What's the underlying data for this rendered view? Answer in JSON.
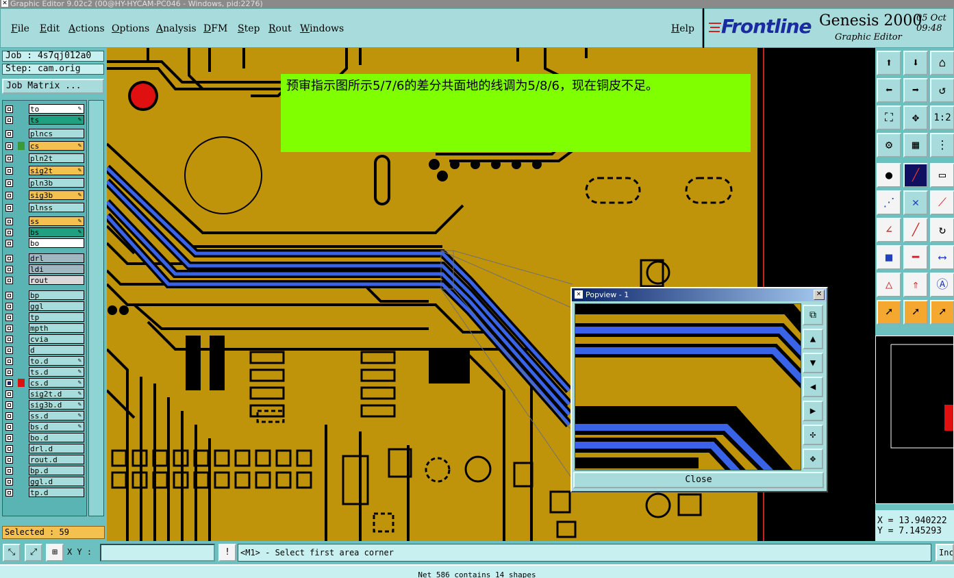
{
  "window": {
    "title": "Graphic Editor 9.02c2 (00@HY-HYCAM-PC046 - Windows, pid:2276)"
  },
  "menu": {
    "items": [
      "File",
      "Edit",
      "Actions",
      "Options",
      "Analysis",
      "DFM",
      "Step",
      "Rout",
      "Windows"
    ],
    "help": "Help"
  },
  "logo": {
    "brand": "Frontline",
    "product": "Genesis 2000",
    "subtitle": "Graphic Editor",
    "date_line1": "05 Oct",
    "date_line2": "09:48"
  },
  "job": {
    "job_label": "Job : 4s7qj012a0",
    "step_label": "Step: cam.orig",
    "matrix_button": "Job Matrix ..."
  },
  "layers": [
    {
      "name": "to",
      "color": "#ffffff",
      "edit": true
    },
    {
      "name": "ts",
      "color": "#20a080",
      "edit": true
    },
    {
      "name": "plncs",
      "color": "#a8dcdc",
      "edit": false
    },
    {
      "name": "cs",
      "color": "#f4c050",
      "edit": true,
      "marker": "#3a9a3a"
    },
    {
      "name": "pln2t",
      "color": "#a8dcdc",
      "edit": false
    },
    {
      "name": "sig2t",
      "color": "#f4c050",
      "edit": true
    },
    {
      "name": "pln3b",
      "color": "#a8dcdc",
      "edit": false
    },
    {
      "name": "sig3b",
      "color": "#f4c050",
      "edit": true
    },
    {
      "name": "plnss",
      "color": "#a8dcdc",
      "edit": false
    },
    {
      "name": "ss",
      "color": "#f4c050",
      "edit": true
    },
    {
      "name": "bs",
      "color": "#20a080",
      "edit": true
    },
    {
      "name": "bo",
      "color": "#ffffff",
      "edit": false
    },
    {
      "name": "drl",
      "color": "#a0b8c0",
      "edit": false
    },
    {
      "name": "ldi",
      "color": "#a0b8c0",
      "edit": false
    },
    {
      "name": "rout",
      "color": "#d8d8d8",
      "edit": false
    },
    {
      "name": "bp",
      "color": "#a8dcdc",
      "edit": false
    },
    {
      "name": "ggl",
      "color": "#a8dcdc",
      "edit": false
    },
    {
      "name": "tp",
      "color": "#a8dcdc",
      "edit": false
    },
    {
      "name": "mpth",
      "color": "#a8dcdc",
      "edit": false
    },
    {
      "name": "cvia",
      "color": "#a8dcdc",
      "edit": false
    },
    {
      "name": "d",
      "color": "#a8dcdc",
      "edit": false
    },
    {
      "name": "to.d",
      "color": "#a8dcdc",
      "edit": true
    },
    {
      "name": "ts.d",
      "color": "#a8dcdc",
      "edit": true
    },
    {
      "name": "cs.d",
      "color": "#a8dcdc",
      "edit": true,
      "active": true
    },
    {
      "name": "sig2t.d",
      "color": "#a8dcdc",
      "edit": true
    },
    {
      "name": "sig3b.d",
      "color": "#a8dcdc",
      "edit": true
    },
    {
      "name": "ss.d",
      "color": "#a8dcdc",
      "edit": true
    },
    {
      "name": "bs.d",
      "color": "#a8dcdc",
      "edit": true
    },
    {
      "name": "bo.d",
      "color": "#a8dcdc",
      "edit": false
    },
    {
      "name": "drl.d",
      "color": "#a8dcdc",
      "edit": false
    },
    {
      "name": "rout.d",
      "color": "#a8dcdc",
      "edit": false
    },
    {
      "name": "bp.d",
      "color": "#a8dcdc",
      "edit": false
    },
    {
      "name": "ggl.d",
      "color": "#a8dcdc",
      "edit": false
    },
    {
      "name": "tp.d",
      "color": "#a8dcdc",
      "edit": false
    }
  ],
  "selected": "Selected : 59",
  "note": {
    "text": "预审指示图所示5/7/6的差分共面地的线调为5/8/6，现在铜皮不足。"
  },
  "popview": {
    "title": "Popview - 1",
    "close_label": "Close"
  },
  "coords": {
    "x": "X = 13.940222",
    "y": "Y = 7.145293"
  },
  "bottom": {
    "xy_label": "X Y :",
    "xy_value": "",
    "warn_icon": "!",
    "message": "<M1> - Select first area corner",
    "inc_label": "Inc"
  },
  "status": "Net 586 contains 14 shapes",
  "colors": {
    "copper": "#c0940a",
    "trace_blue": "#3a64e8",
    "panel": "#a8dcdc",
    "note_bg": "#80ff00"
  }
}
